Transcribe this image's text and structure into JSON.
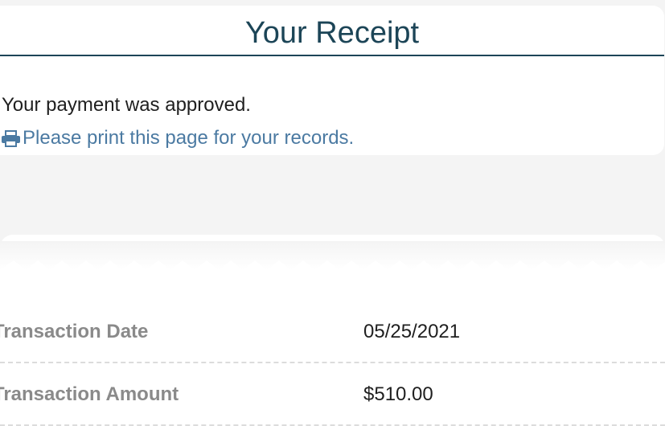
{
  "header": {
    "title": "Your Receipt",
    "approved_message": "Your payment was approved.",
    "print_link": "Please print this page for your records.",
    "print_icon": "printer-icon"
  },
  "receipt": {
    "rows": [
      {
        "label": "Transaction Date",
        "value": "05/25/2021"
      },
      {
        "label": "Transaction Amount",
        "value": "$510.00"
      }
    ]
  },
  "colors": {
    "background": "#f4f4f4",
    "title": "#1c4557",
    "link": "#4b7aa2",
    "label": "#8a8a8a"
  }
}
